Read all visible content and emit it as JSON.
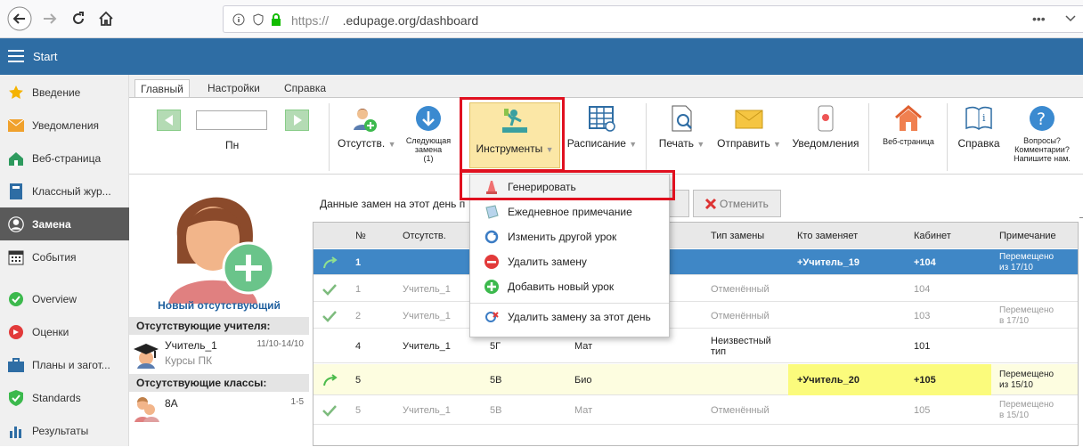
{
  "browser": {
    "url_prefix": "https://",
    "url_domain": ".edupage.org/dashboard"
  },
  "appbar": {
    "title": "Start"
  },
  "sidebar": {
    "items": [
      {
        "label": "Введение"
      },
      {
        "label": "Уведомления"
      },
      {
        "label": "Веб-страница"
      },
      {
        "label": "Классный жур..."
      },
      {
        "label": "Замена"
      },
      {
        "label": "События"
      },
      {
        "label": "Overview"
      },
      {
        "label": "Оценки"
      },
      {
        "label": "Планы и загот..."
      },
      {
        "label": "Standards"
      },
      {
        "label": "Результаты"
      }
    ]
  },
  "ribbon": {
    "tabs": [
      {
        "label": "Главный"
      },
      {
        "label": "Настройки"
      },
      {
        "label": "Справка"
      }
    ],
    "day_label": "Пн",
    "absent_label": "Отсутств.",
    "next_sub_label": [
      "Следующая",
      "замена",
      "(1)"
    ],
    "tools_label": "Инструменты",
    "schedule_label": "Расписание",
    "print_label": "Печать",
    "send_label": "Отправить",
    "notifications_label": "Уведомления",
    "webpage_label": "Веб-страница",
    "help_label": "Справка",
    "questions_label": [
      "Вопросы?",
      "Комментарии?",
      "Напишите нам."
    ]
  },
  "dropdown": {
    "items": [
      {
        "label": "Генерировать"
      },
      {
        "label": "Ежедневное примечание"
      },
      {
        "label": "Изменить другой урок"
      },
      {
        "label": "Удалить замену"
      },
      {
        "label": "Добавить новый урок"
      },
      {
        "label": "Удалить замену за этот день"
      }
    ]
  },
  "leftpanel": {
    "new_absent": "Новый отсутствующий",
    "absent_teachers_title": "Отсутствующие учителя:",
    "teacher": {
      "name": "Учитель_1",
      "dates": "11/10-14/10",
      "reason": "Курсы ПК"
    },
    "absent_classes_title": "Отсутствующие классы:",
    "class_item": {
      "name": "8A",
      "periods": "1-5"
    }
  },
  "main": {
    "info_text": "Данные замен на этот день п",
    "cancel_label": "Отменить",
    "columns": [
      "№",
      "Отсутств.",
      "Тип замены",
      "Кто заменяет",
      "Кабинет",
      "Примечание"
    ],
    "rows": [
      {
        "num": "1",
        "absent": "",
        "class": "",
        "subject": "",
        "type": "",
        "who": "+Учитель_19",
        "room": "+104",
        "note": [
          "Перемещено",
          "из 17/10"
        ]
      },
      {
        "num": "1",
        "absent": "Учитель_1",
        "class": "",
        "subject": "",
        "type": "Отменённый",
        "who": "",
        "room": "104",
        "note": [
          "",
          ""
        ]
      },
      {
        "num": "2",
        "absent": "Учитель_1",
        "class": "",
        "subject": "",
        "type": "Отменённый",
        "who": "",
        "room": "103",
        "note": [
          "Перемещено",
          "в 17/10"
        ]
      },
      {
        "num": "4",
        "absent": "Учитель_1",
        "class": "5Г",
        "subject": "Мат",
        "type": "Неизвестный тип",
        "who": "",
        "room": "101",
        "note": [
          "",
          ""
        ]
      },
      {
        "num": "5",
        "absent": "",
        "class": "5В",
        "subject": "Био",
        "type": "",
        "who": "+Учитель_20",
        "room": "+105",
        "note": [
          "Перемещено",
          "из 15/10"
        ]
      },
      {
        "num": "5",
        "absent": "Учитель_1",
        "class": "5В",
        "subject": "Мат",
        "type": "Отменённый",
        "who": "",
        "room": "105",
        "note": [
          "Перемещено",
          "в 15/10"
        ]
      }
    ]
  }
}
